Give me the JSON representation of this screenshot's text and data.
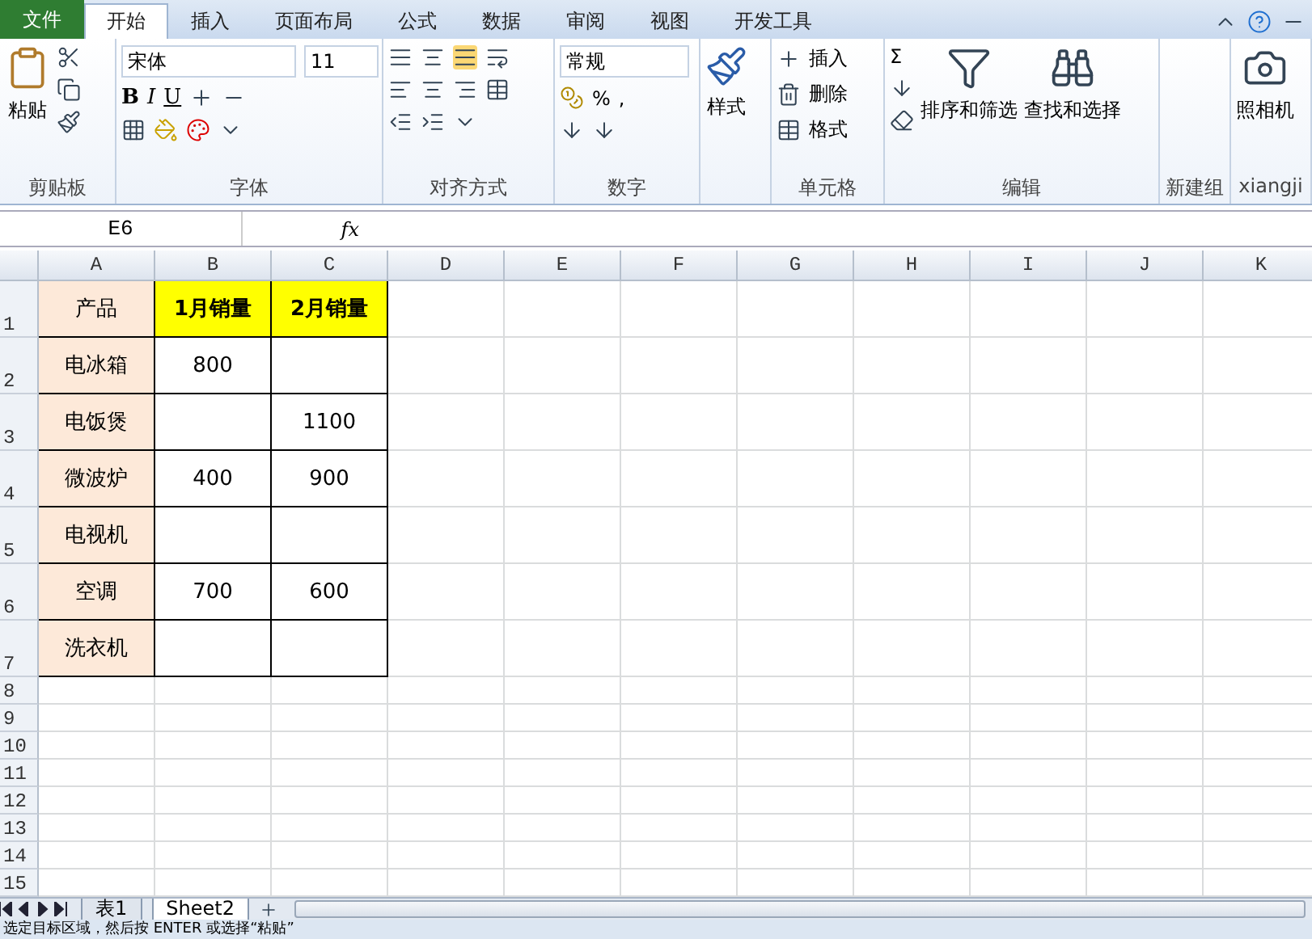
{
  "menu_tabs": [
    {
      "label": "文件",
      "kind": "file",
      "selected": false
    },
    {
      "label": "开始",
      "kind": "tab",
      "selected": true
    },
    {
      "label": "插入",
      "kind": "tab",
      "selected": false
    },
    {
      "label": "页面布局",
      "kind": "tab",
      "selected": false
    },
    {
      "label": "公式",
      "kind": "tab",
      "selected": false
    },
    {
      "label": "数据",
      "kind": "tab",
      "selected": false
    },
    {
      "label": "审阅",
      "kind": "tab",
      "selected": false
    },
    {
      "label": "视图",
      "kind": "tab",
      "selected": false
    },
    {
      "label": "开发工具",
      "kind": "tab",
      "selected": false
    }
  ],
  "ribbon": {
    "clipboard": {
      "label": "剪贴板",
      "paste": "粘贴"
    },
    "font": {
      "label": "字体",
      "font_name": "宋体",
      "font_size": "11",
      "bold": "B",
      "italic": "I",
      "underline": "U"
    },
    "alignment": {
      "label": "对齐方式"
    },
    "number": {
      "label": "数字",
      "format": "常规",
      "percent": "%",
      "comma": ","
    },
    "styles": {
      "button": "样式"
    },
    "cells": {
      "label": "单元格",
      "buttons": [
        "插入",
        "删除",
        "格式"
      ]
    },
    "editing": {
      "label": "编辑",
      "sum": "Σ",
      "sort": "排序和筛选",
      "find": "查找和选择"
    },
    "new_group": {
      "label": "新建组"
    },
    "xiangji": {
      "label": "xiangji",
      "camera": "照相机"
    }
  },
  "name_box": "E6",
  "formula_label": "fx",
  "columns": [
    "A",
    "B",
    "C",
    "D",
    "E",
    "F",
    "G",
    "H",
    "I",
    "J",
    "K"
  ],
  "rows": [
    {
      "number": "1",
      "cells": [
        {
          "kind": "label",
          "text": "产品"
        },
        {
          "kind": "title",
          "text": "1月销量"
        },
        {
          "kind": "title",
          "text": "2月销量"
        }
      ]
    },
    {
      "number": "2",
      "cells": [
        {
          "kind": "label",
          "text": "电冰箱"
        },
        {
          "kind": "value",
          "text": "800"
        },
        {
          "kind": "value",
          "text": ""
        }
      ]
    },
    {
      "number": "3",
      "cells": [
        {
          "kind": "label",
          "text": "电饭煲"
        },
        {
          "kind": "value",
          "text": ""
        },
        {
          "kind": "value",
          "text": "1100"
        }
      ]
    },
    {
      "number": "4",
      "cells": [
        {
          "kind": "label",
          "text": "微波炉"
        },
        {
          "kind": "value",
          "text": "400"
        },
        {
          "kind": "value",
          "text": "900"
        }
      ]
    },
    {
      "number": "5",
      "cells": [
        {
          "kind": "label",
          "text": "电视机"
        },
        {
          "kind": "value",
          "text": ""
        },
        {
          "kind": "value",
          "text": ""
        }
      ]
    },
    {
      "number": "6",
      "cells": [
        {
          "kind": "label",
          "text": "空调"
        },
        {
          "kind": "value",
          "text": "700"
        },
        {
          "kind": "value",
          "text": "600"
        }
      ]
    },
    {
      "number": "7",
      "cells": [
        {
          "kind": "label",
          "text": "洗衣机"
        },
        {
          "kind": "value",
          "text": ""
        },
        {
          "kind": "value",
          "text": ""
        }
      ]
    },
    {
      "number": "8"
    },
    {
      "number": "9"
    },
    {
      "number": "10"
    },
    {
      "number": "11"
    },
    {
      "number": "12"
    },
    {
      "number": "13"
    },
    {
      "number": "14"
    },
    {
      "number": "15"
    }
  ],
  "sheet_tabs": [
    {
      "label": "表1",
      "selected": false
    },
    {
      "label": "Sheet2",
      "selected": true
    }
  ],
  "status_bar": "选定目标区域，然后按 ENTER 或选择“粘贴”"
}
